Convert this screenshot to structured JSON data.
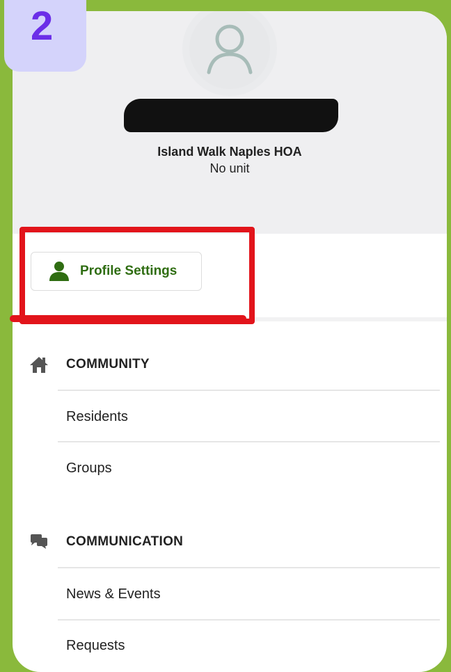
{
  "step_badge": "2",
  "profile": {
    "org_name": "Island Walk Naples HOA",
    "unit": "No unit"
  },
  "profile_settings": {
    "label": "Profile Settings",
    "icon": "person-icon"
  },
  "sections": [
    {
      "title": "COMMUNITY",
      "icon": "home-icon",
      "items": [
        "Residents",
        "Groups"
      ]
    },
    {
      "title": "COMMUNICATION",
      "icon": "chat-bubbles-icon",
      "items": [
        "News & Events",
        "Requests"
      ]
    }
  ],
  "colors": {
    "frame_green": "#8ab93c",
    "accent_green": "#2f6d12",
    "annotation_red": "#e2141b",
    "badge_bg": "#d4d3fb",
    "badge_text": "#6b2ee8"
  }
}
